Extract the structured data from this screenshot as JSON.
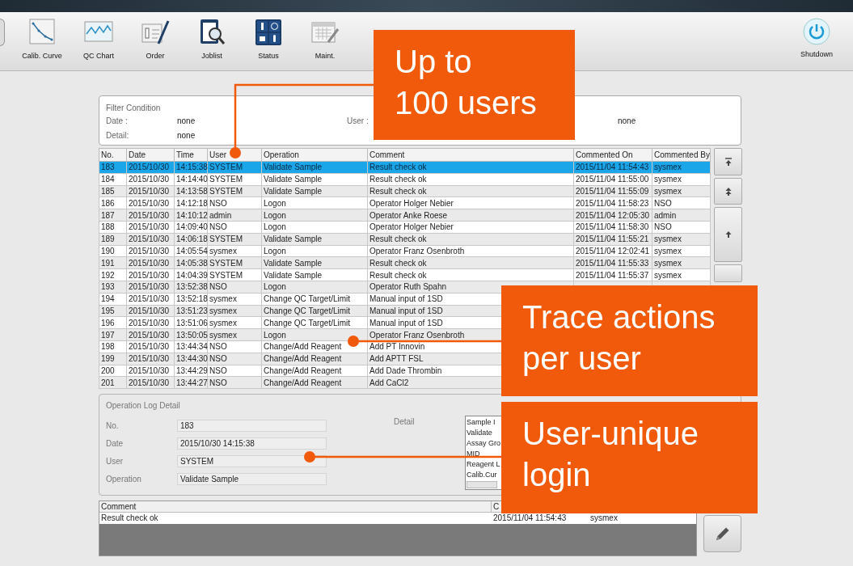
{
  "toolbar": {
    "items": [
      {
        "label": "Calib. Curve",
        "kind": "curve"
      },
      {
        "label": "QC Chart",
        "kind": "chart"
      },
      {
        "label": "Order",
        "kind": "order"
      },
      {
        "label": "Joblist",
        "kind": "joblist"
      },
      {
        "label": "Status",
        "kind": "status"
      },
      {
        "label": "Maint.",
        "kind": "maint"
      }
    ],
    "shutdown": {
      "label": "Shutdown"
    }
  },
  "filter": {
    "title": "Filter Condition",
    "fields": [
      {
        "label": "Date :",
        "value": "none"
      },
      {
        "label": "Detail:",
        "value": "none"
      },
      {
        "label": "User :"
      },
      {
        "value": "none"
      }
    ]
  },
  "log_table": {
    "columns": [
      "No.",
      "Date",
      "Time",
      "User",
      "Operation",
      "Comment",
      "Commented On",
      "Commented By"
    ],
    "rows": [
      {
        "no": "183",
        "date": "2015/10/30",
        "time": "14:15:38",
        "user": "SYSTEM",
        "operation": "Validate Sample",
        "comment": "Result check ok",
        "commented_on": "2015/11/04 11:54:43",
        "commented_by": "sysmex",
        "selected": true
      },
      {
        "no": "184",
        "date": "2015/10/30",
        "time": "14:14:40",
        "user": "SYSTEM",
        "operation": "Validate Sample",
        "comment": "Result check ok",
        "commented_on": "2015/11/04 11:55:00",
        "commented_by": "sysmex",
        "selected": false
      },
      {
        "no": "185",
        "date": "2015/10/30",
        "time": "14:13:58",
        "user": "SYSTEM",
        "operation": "Validate Sample",
        "comment": "Result check ok",
        "commented_on": "2015/11/04 11:55:09",
        "commented_by": "sysmex",
        "selected": false
      },
      {
        "no": "186",
        "date": "2015/10/30",
        "time": "14:12:18",
        "user": "NSO",
        "operation": "Logon",
        "comment": "Operator Holger Nebier",
        "commented_on": "2015/11/04 11:58:23",
        "commented_by": "NSO",
        "selected": false
      },
      {
        "no": "187",
        "date": "2015/10/30",
        "time": "14:10:12",
        "user": "admin",
        "operation": "Logon",
        "comment": "Operator Anke Roese",
        "commented_on": "2015/11/04 12:05:30",
        "commented_by": "admin",
        "selected": false
      },
      {
        "no": "188",
        "date": "2015/10/30",
        "time": "14:09:40",
        "user": "NSO",
        "operation": "Logon",
        "comment": "Operator Holger Nebier",
        "commented_on": "2015/11/04 11:58:30",
        "commented_by": "NSO",
        "selected": false
      },
      {
        "no": "189",
        "date": "2015/10/30",
        "time": "14:06:18",
        "user": "SYSTEM",
        "operation": "Validate Sample",
        "comment": "Result check ok",
        "commented_on": "2015/11/04 11:55:21",
        "commented_by": "sysmex",
        "selected": false
      },
      {
        "no": "190",
        "date": "2015/10/30",
        "time": "14:05:54",
        "user": "sysmex",
        "operation": "Logon",
        "comment": "Operator Franz Osenbroth",
        "commented_on": "2015/11/04 12:02:41",
        "commented_by": "sysmex",
        "selected": false
      },
      {
        "no": "191",
        "date": "2015/10/30",
        "time": "14:05:38",
        "user": "SYSTEM",
        "operation": "Validate Sample",
        "comment": "Result check ok",
        "commented_on": "2015/11/04 11:55:33",
        "commented_by": "sysmex",
        "selected": false
      },
      {
        "no": "192",
        "date": "2015/10/30",
        "time": "14:04:39",
        "user": "SYSTEM",
        "operation": "Validate Sample",
        "comment": "Result check ok",
        "commented_on": "2015/11/04 11:55:37",
        "commented_by": "sysmex",
        "selected": false
      },
      {
        "no": "193",
        "date": "2015/10/30",
        "time": "13:52:38",
        "user": "NSO",
        "operation": "Logon",
        "comment": "Operator Ruth Spahn",
        "selected": false
      },
      {
        "no": "194",
        "date": "2015/10/30",
        "time": "13:52:18",
        "user": "sysmex",
        "operation": "Change QC Target/Limit",
        "comment": "Manual input of 1SD",
        "selected": false
      },
      {
        "no": "195",
        "date": "2015/10/30",
        "time": "13:51:23",
        "user": "sysmex",
        "operation": "Change QC Target/Limit",
        "comment": "Manual input of 1SD",
        "selected": false
      },
      {
        "no": "196",
        "date": "2015/10/30",
        "time": "13:51:06",
        "user": "sysmex",
        "operation": "Change QC Target/Limit",
        "comment": "Manual input of 1SD",
        "selected": false
      },
      {
        "no": "197",
        "date": "2015/10/30",
        "time": "13:50:05",
        "user": "sysmex",
        "operation": "Logon",
        "comment": "Operator Franz Osenbroth",
        "selected": false
      },
      {
        "no": "198",
        "date": "2015/10/30",
        "time": "13:44:34",
        "user": "NSO",
        "operation": "Change/Add Reagent",
        "comment": "Add PT Innovin",
        "selected": false
      },
      {
        "no": "199",
        "date": "2015/10/30",
        "time": "13:44:30",
        "user": "NSO",
        "operation": "Change/Add Reagent",
        "comment": "Add APTT FSL",
        "selected": false
      },
      {
        "no": "200",
        "date": "2015/10/30",
        "time": "13:44:29",
        "user": "NSO",
        "operation": "Change/Add Reagent",
        "comment": "Add Dade Thrombin",
        "selected": false
      },
      {
        "no": "201",
        "date": "2015/10/30",
        "time": "13:44:27",
        "user": "NSO",
        "operation": "Change/Add Reagent",
        "comment": "Add CaCl2",
        "selected": false
      }
    ]
  },
  "detail": {
    "title": "Operation Log Detail",
    "fields": [
      {
        "label": "No.",
        "value": "183"
      },
      {
        "label": "Date",
        "value": "2015/10/30 14:15:38"
      },
      {
        "label": "User",
        "value": "SYSTEM"
      },
      {
        "label": "Operation",
        "value": "Validate Sample"
      }
    ],
    "detail_label": "Detail",
    "detail_lines": [
      "Sample I",
      "Validate",
      "Assay Gro",
      "MID",
      "Reagent L",
      "Calib.Cur"
    ]
  },
  "comment_table": {
    "columns": [
      "Comment",
      "C"
    ],
    "rows": [
      {
        "comment": "Result check ok",
        "commented_on": "2015/11/04 11:54:43",
        "commented_by": "sysmex"
      }
    ]
  },
  "callouts": [
    {
      "text": "Up to\n100 users"
    },
    {
      "text": "Trace actions\nper user"
    },
    {
      "text": "User-unique\nlogin"
    }
  ]
}
